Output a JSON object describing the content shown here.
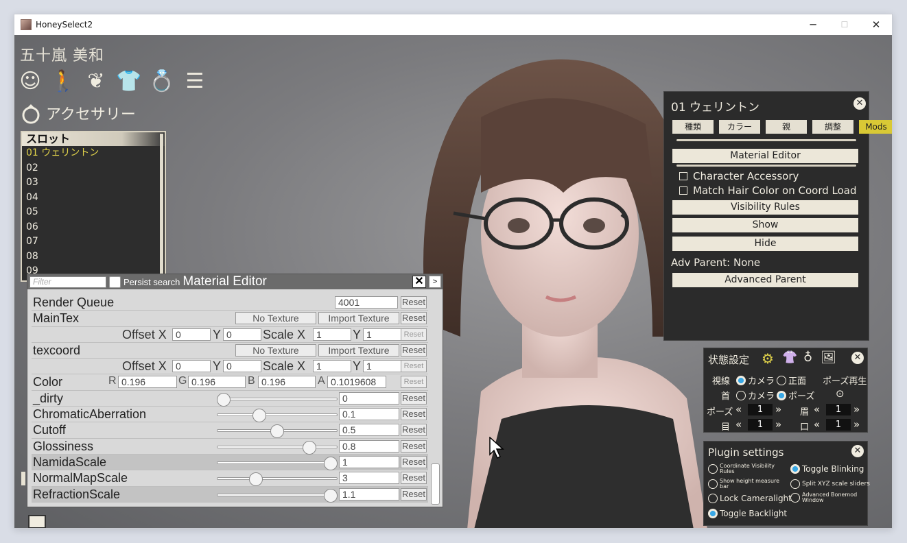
{
  "window": {
    "title": "HoneySelect2",
    "min": "─",
    "max": "☐",
    "close": "✕"
  },
  "character": {
    "name": "五十嵐 美和"
  },
  "category_tabs": [
    {
      "name": "face-icon",
      "glyph": "☺"
    },
    {
      "name": "body-icon",
      "glyph": "🚶"
    },
    {
      "name": "hair-icon",
      "glyph": "❦"
    },
    {
      "name": "clothes-icon",
      "glyph": "👕"
    },
    {
      "name": "accessory-icon",
      "glyph": "💍"
    },
    {
      "name": "list-icon",
      "glyph": "☰"
    }
  ],
  "accessory": {
    "title": "アクセサリー",
    "icon": "ring-icon"
  },
  "slots": {
    "header": "スロット",
    "items": [
      "01 ウェリントン",
      "02",
      "03",
      "04",
      "05",
      "06",
      "07",
      "08",
      "09"
    ]
  },
  "material_editor": {
    "filter_placeholder": "Filter",
    "persist_label": "Persist search",
    "title": "Material Editor",
    "close": "✕",
    "expand": ">",
    "reset": "Reset",
    "render_queue": {
      "label": "Render Queue",
      "value": "4001"
    },
    "maintex": {
      "label": "MainTex",
      "no_texture": "No Texture",
      "import": "Import Texture"
    },
    "maintex_offset": {
      "offset": "Offset X",
      "ox": "0",
      "y": "Y",
      "oy": "0",
      "scale": "Scale X",
      "sx": "1",
      "sy": "1"
    },
    "texcoord": {
      "label": "texcoord",
      "no_texture": "No Texture",
      "import": "Import Texture"
    },
    "texcoord_offset": {
      "offset": "Offset X",
      "ox": "0",
      "y": "Y",
      "oy": "0",
      "scale": "Scale X",
      "sx": "1",
      "sy": "1"
    },
    "color": {
      "label": "Color",
      "r_label": "R",
      "r": "0.196",
      "g_label": "G",
      "g": "0.196",
      "b_label": "B",
      "b": "0.196",
      "a_label": "A",
      "a": "0.1019608"
    },
    "sliders": [
      {
        "label": "_dirty",
        "value": "0",
        "pos": 0.05
      },
      {
        "label": "ChromaticAberration",
        "value": "0.1",
        "pos": 0.35
      },
      {
        "label": "Cutoff",
        "value": "0.5",
        "pos": 0.5
      },
      {
        "label": "Glossiness",
        "value": "0.8",
        "pos": 0.77
      },
      {
        "label": "NamidaScale",
        "value": "1",
        "pos": 0.95
      },
      {
        "label": "NormalMapScale",
        "value": "3",
        "pos": 0.32
      },
      {
        "label": "RefractionScale",
        "value": "1.1",
        "pos": 0.95
      }
    ]
  },
  "acc_panel": {
    "title": "01 ウェリントン",
    "tabs": [
      "種類",
      "カラー",
      "親",
      "調整",
      "Mods"
    ],
    "material_editor": "Material Editor",
    "char_accessory": "Character Accessory",
    "match_hair": "Match Hair Color on Coord Load",
    "visibility": "Visibility Rules",
    "show": "Show",
    "hide": "Hide",
    "adv_parent_label": "Adv Parent: None",
    "advanced_parent": "Advanced Parent"
  },
  "state_panel": {
    "title": "状態設定",
    "gaze_label": "視線",
    "gaze_camera": "カメラ",
    "gaze_front": "正面",
    "pose_play": "ポーズ再生",
    "neck_label": "首",
    "neck_camera": "カメラ",
    "neck_pose": "ポーズ",
    "pose_label": "ポーズ",
    "pose_val": "1",
    "brow_label": "眉",
    "brow_val": "1",
    "eye_label": "目",
    "eye_val": "1",
    "mouth_label": "口",
    "mouth_val": "1"
  },
  "plugin_panel": {
    "title": "Plugin settings",
    "coord_vis": "Coordinate Visibility Rules",
    "toggle_blink": "Toggle Blinking",
    "show_height": "Show height measure bar",
    "split_xyz": "Split XYZ scale sliders",
    "lock_camlight": "Lock Cameralight",
    "adv_bonemod": "Advanced Bonemod Window",
    "toggle_backlight": "Toggle Backlight"
  }
}
